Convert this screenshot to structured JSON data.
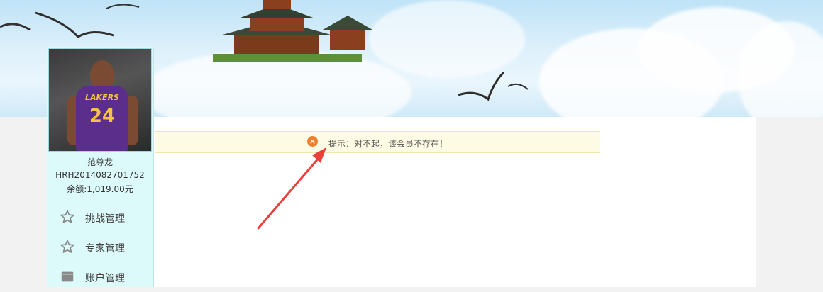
{
  "user": {
    "name": "范尊龙",
    "id": "HRH2014082701752",
    "balance": "余额:1,019.00元",
    "jersey_team": "LAKERS",
    "jersey_number": "24"
  },
  "sidebar": {
    "items": [
      {
        "label": "挑战管理",
        "icon": "star-icon"
      },
      {
        "label": "专家管理",
        "icon": "star-icon"
      },
      {
        "label": "账户管理",
        "icon": "wallet-icon"
      }
    ]
  },
  "alert": {
    "icon": "close-circle-icon",
    "text": "提示：对不起，该会员不存在！"
  },
  "colors": {
    "sidebar_bg": "#ddfafa",
    "alert_bg": "#fdfbe3",
    "alert_icon": "#f07f2b",
    "annotation_arrow": "#e8413a"
  }
}
